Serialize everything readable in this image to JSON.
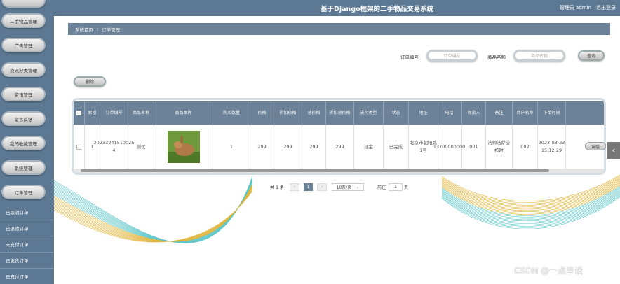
{
  "header": {
    "title": "基于Django框架的二手物品交易系统",
    "user_label": "管理员 admin",
    "logout": "退出登录"
  },
  "sidebar": {
    "pills": [
      "二手物品管理",
      "广告管理",
      "资讯分类管理",
      "资讯管理",
      "留言反馈",
      "我的收藏管理",
      "系统管理",
      "订单管理"
    ],
    "subs": [
      "已取消订单",
      "已退款订单",
      "未支付订单",
      "已发货订单",
      "已支付订单"
    ]
  },
  "breadcrumb": {
    "home": "系统首页",
    "sep": "⁝",
    "current": "订单管理"
  },
  "search": {
    "order_label": "订单编号",
    "order_placeholder": "订单编号",
    "product_label": "商品名称",
    "product_placeholder": "商品名称",
    "query_btn": "查询"
  },
  "actions": {
    "delete_btn": "删除"
  },
  "table": {
    "headers": [
      "",
      "索引",
      "订单编号",
      "商品名称",
      "商品图片",
      "购买数量",
      "价格",
      "折扣价格",
      "总价格",
      "折扣总价格",
      "支付类型",
      "状态",
      "地址",
      "电话",
      "收货人",
      "备注",
      "商户名称",
      "下单时间"
    ],
    "row": {
      "index": "1",
      "order_no": "20233241510025 4",
      "name": "测试",
      "qty": "1",
      "price": "299",
      "discount_price": "299",
      "total": "299",
      "discount_total": "299",
      "pay_type": "现金",
      "status": "已完成",
      "address": "北京市朝阳路1号",
      "phone": "13700000000",
      "receiver": "001",
      "note": "法师法萨芬按时",
      "merchant": "002",
      "time": "2023-03-23 15:12:29",
      "detail": "详情"
    }
  },
  "pagination": {
    "total": "共 1 条",
    "prev": "‹",
    "page": "1",
    "next": "›",
    "per_page": "10条/页",
    "goto": "前往",
    "goto_val": "1",
    "page_unit": "页"
  },
  "watermark": "CSDN @一点毕设",
  "colors": {
    "primary": "#5c7892",
    "header_row": "#6b8298"
  }
}
